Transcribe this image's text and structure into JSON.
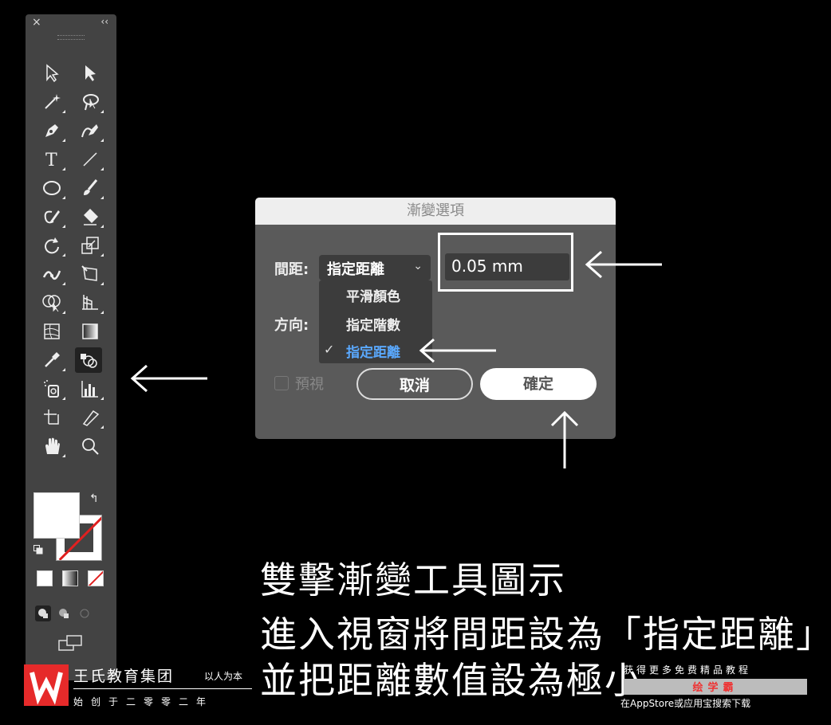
{
  "toolbar": {
    "close": "×",
    "collapse": "‹‹",
    "swap": "↰"
  },
  "dialog": {
    "title": "漸變選項",
    "spacing_label": "間距:",
    "spacing_selected": "指定距離",
    "spacing_value": "0.05 mm",
    "direction_label": "方向:",
    "options": [
      "平滑顏色",
      "指定階數",
      "指定距離"
    ],
    "selected_option": "指定距離",
    "preview_label": "預視",
    "cancel_label": "取消",
    "ok_label": "確定"
  },
  "captions": {
    "line1": "雙擊漸變工具圖示",
    "line2": "進入視窗將間距設為「指定距離」",
    "line3": "並把距離數值設為極小"
  },
  "watermark": {
    "org_name": "王氏教育集团",
    "motto": "以人为本",
    "since": "始创于二零零二年",
    "ad_top": "获得更多免费精品教程",
    "ad_brand": "绘学霸",
    "ad_bottom": "在AppStore或应用宝搜索下载"
  },
  "colors": {
    "accent": "#5aa9ff",
    "logo_red": "#e62a2a",
    "panel": "#434343",
    "dialog": "#5a5a5a"
  }
}
